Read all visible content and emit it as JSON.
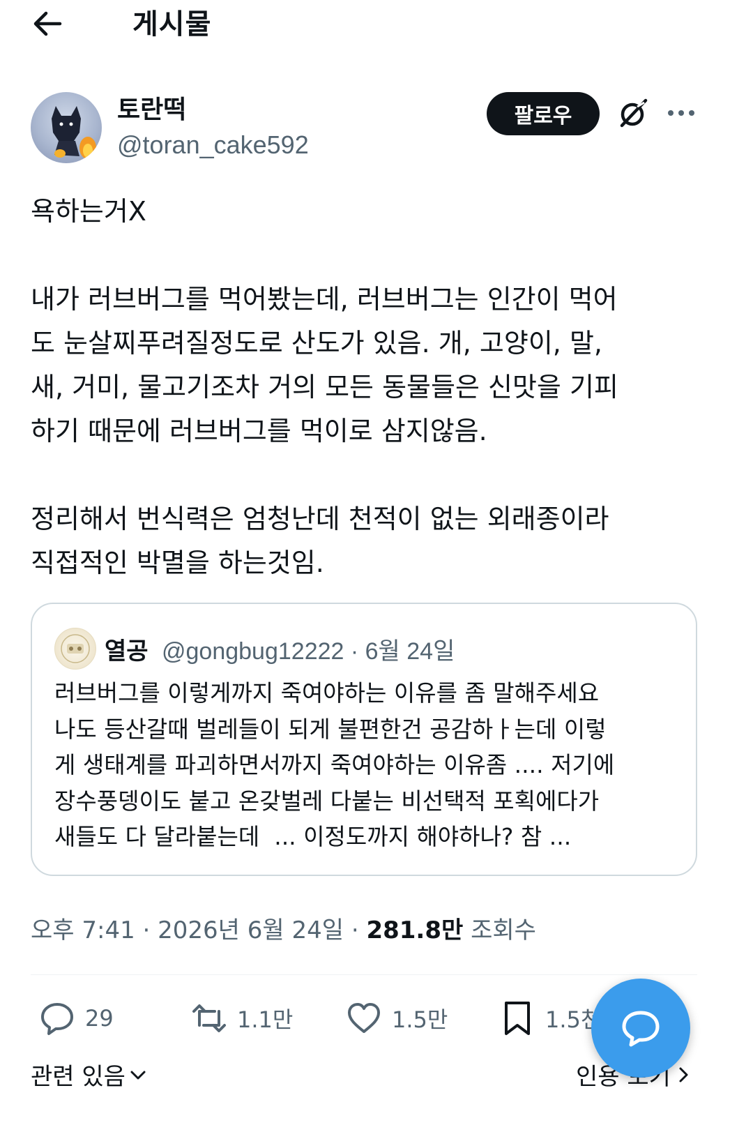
{
  "header": {
    "title": "게시물",
    "back_icon": "arrow-left-icon"
  },
  "author": {
    "name": "토란떡",
    "handle": "@toran_cake592",
    "follow_label": "팔로우",
    "grok_icon": "grok-icon",
    "more_icon": "more-horizontal-icon"
  },
  "tweet": {
    "text": "욕하는거X\n\n내가 러브버그를 먹어봤는데, 러브버그는 인간이 먹어\n도 눈살찌푸려질정도로 산도가 있음. 개, 고양이, 말,\n새, 거미, 물고기조차 거의 모든 동물들은 신맛을 기피\n하기 때문에 러브버그를 먹이로 삼지않음.\n\n정리해서 번식력은 엄청난데 천적이 없는 외래종이라\n직접적인 박멸을 하는것임."
  },
  "quote": {
    "name": "열공",
    "handle_date": "@gongbug12222 · 6월 24일",
    "text": "러브버그를 이렇게까지 죽여야하는 이유를 좀 말해주세요\n나도 등산갈때 벌레들이 되게 불편한건 공감하ㅏ는데 이렇\n게 생태계를 파괴하면서까지 죽여야하는 이유좀 .... 저기에\n장수풍뎅이도 붙고 온갖벌레 다붙는 비선택적 포획에다가\n새들도 다 달라붙는데  ... 이정도까지 해야하나? 참 ..."
  },
  "meta": {
    "time_date": "오후 7:41 · 2026년 6월 24일 · ",
    "views": "281.8만",
    "views_label": " 조회수"
  },
  "actions": {
    "replies": "29",
    "reposts": "1.1만",
    "likes": "1.5만",
    "bookmarks": "1.5천"
  },
  "bottom": {
    "related": "관련 있음",
    "quotes": "인용 보기"
  },
  "colors": {
    "text": "#0f1419",
    "secondary": "#536471",
    "border": "#cfd9de",
    "fab": "#3b9cec"
  }
}
